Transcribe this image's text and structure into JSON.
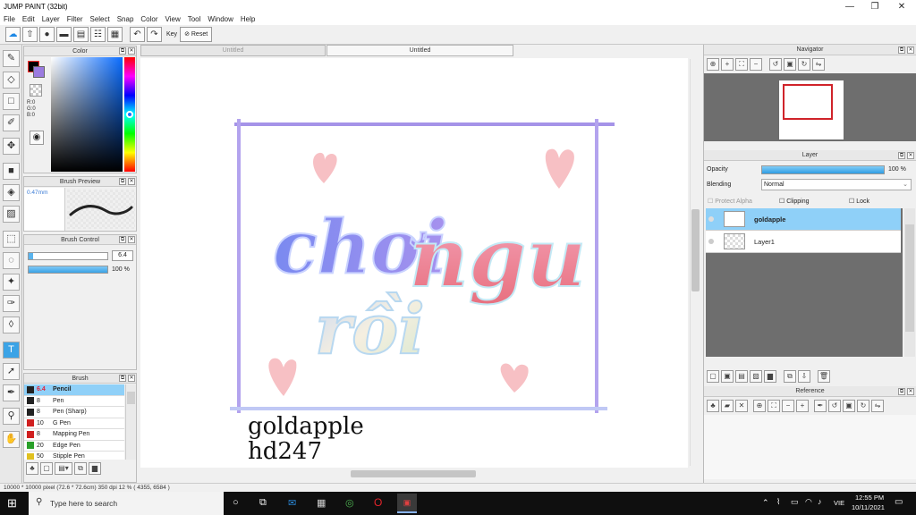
{
  "window": {
    "title": "JUMP PAINT (32bit)",
    "min": "—",
    "max": "❐",
    "close": "✕"
  },
  "menu": [
    "File",
    "Edit",
    "Layer",
    "Filter",
    "Select",
    "Snap",
    "Color",
    "View",
    "Tool",
    "Window",
    "Help"
  ],
  "toolbar": {
    "key_label": "Key",
    "reset_label": "Reset",
    "icons": [
      "cloud-icon",
      "export-icon",
      "comment-icon",
      "chat-icon",
      "page-icon",
      "layout-icon",
      "grid-icon"
    ]
  },
  "color_panel": {
    "title": "Color",
    "r": "R:0",
    "g": "G:0",
    "b": "B:0",
    "primary": "#000000",
    "secondary": "#9b7be0"
  },
  "brush_preview": {
    "title": "Brush Preview",
    "size": "0.47mm"
  },
  "brush_control": {
    "title": "Brush Control",
    "size_value": "6.4",
    "opacity_value": "100 %",
    "size_fill": 0.06,
    "opacity_fill": 1.0
  },
  "brush_panel": {
    "title": "Brush",
    "items": [
      {
        "size": "6.4",
        "name": "Pencil",
        "color": "#222222",
        "selected": true
      },
      {
        "size": "8",
        "name": "Pen",
        "color": "#222222"
      },
      {
        "size": "8",
        "name": "Pen (Sharp)",
        "color": "#222222"
      },
      {
        "size": "10",
        "name": "G Pen",
        "color": "#d02020"
      },
      {
        "size": "8",
        "name": "Mapping Pen",
        "color": "#d02020"
      },
      {
        "size": "20",
        "name": "Edge Pen",
        "color": "#2aa02a"
      },
      {
        "size": "50",
        "name": "Stipple Pen",
        "color": "#e0c020"
      }
    ]
  },
  "tabs": [
    "Untitled",
    "Untitled"
  ],
  "canvas": {
    "title1": "choi ngu",
    "title2": "rồi",
    "sig1": "goldapple",
    "sig2": "hd247"
  },
  "navigator": {
    "title": "Navigator"
  },
  "layer_panel": {
    "title": "Layer",
    "opacity_label": "Opacity",
    "opacity_value": "100 %",
    "blending_label": "Blending",
    "blending_value": "Normal",
    "protect_alpha": "Protect Alpha",
    "clipping": "Clipping",
    "lock": "Lock",
    "layers": [
      {
        "name": "goldapple",
        "selected": true
      },
      {
        "name": "Layer1",
        "selected": false
      }
    ]
  },
  "reference": {
    "title": "Reference"
  },
  "status": "10000 * 10000 pixel   (72.6 * 72.6cm)   350 dpi   12 %   ( 4355, 6584 )",
  "taskbar": {
    "search_placeholder": "Type here to search",
    "lang": "VIE",
    "time": "12:55 PM",
    "date": "10/11/2021"
  }
}
